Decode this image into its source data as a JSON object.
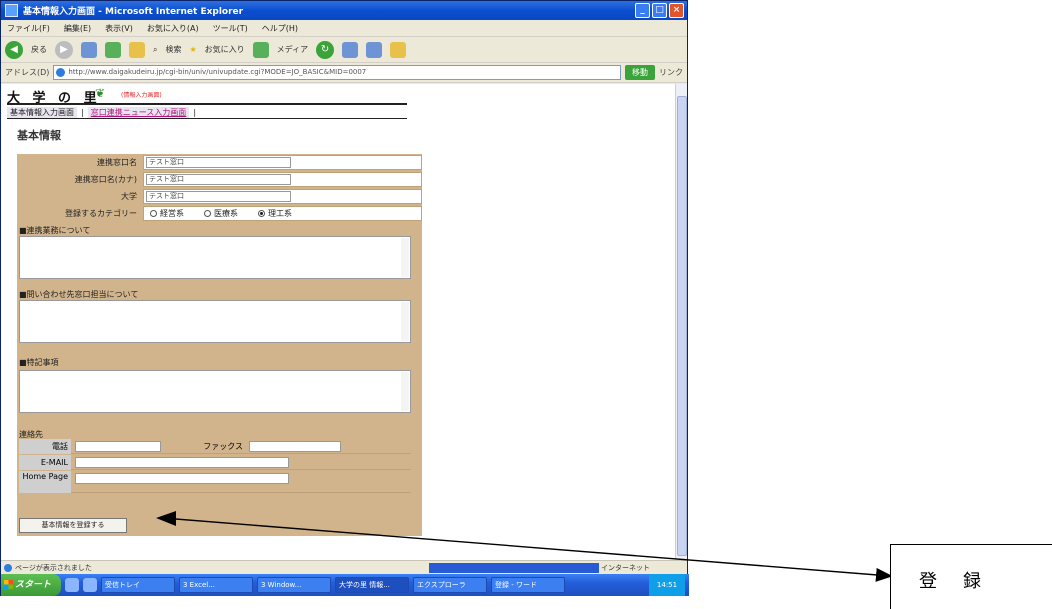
{
  "window": {
    "title": "基本情報入力画面 - Microsoft Internet Explorer"
  },
  "menubar": [
    "ファイル(F)",
    "編集(E)",
    "表示(V)",
    "お気に入り(A)",
    "ツール(T)",
    "ヘルプ(H)"
  ],
  "toolbar": {
    "back_label": "戻る",
    "search_label": "検索",
    "favorites_label": "お気に入り",
    "media_label": "メディア"
  },
  "address": {
    "label": "アドレス(D)",
    "value": "http://www.daigakudeiru.jp/cgi-bin/univ/univupdate.cgi?MODE=JO_BASIC&MID=0007",
    "go_label": "移動",
    "links_label": "リンク"
  },
  "header": {
    "logo": "大 学 の 里",
    "badge": "(情報入力画面)"
  },
  "breadcrumb": {
    "current": "基本情報入力画面",
    "link": "窓口連携ニュース入力画面"
  },
  "page": {
    "title": "基本情報"
  },
  "form": {
    "fields": [
      {
        "label": "連携窓口名",
        "value": "テスト窓口"
      },
      {
        "label": "連携窓口名(カナ)",
        "value": "テスト窓口"
      },
      {
        "label": "大学",
        "value": "テスト窓口"
      }
    ],
    "category": {
      "label": "登録するカテゴリー",
      "options": [
        "経営系",
        "医療系",
        "理工系"
      ],
      "selected": "理工系"
    },
    "sections": [
      "■連携業務について",
      "■問い合わせ先窓口担当について",
      "■特記事項"
    ],
    "contact": {
      "heading": "連絡先",
      "phone_label": "電話",
      "fax_label": "ファックス",
      "email_label": "E-MAIL",
      "homepage_label": "Home Page"
    },
    "submit_label": "基本情報を登録する"
  },
  "status": {
    "text": "ページが表示されました",
    "zone": "インターネット"
  },
  "taskbar": {
    "start_label": "スタート",
    "tasks": [
      "受信トレイ",
      "3 Excel...",
      "3 Window...",
      "大学の里 情報...",
      "エクスプローラ",
      "登録 - ワード"
    ],
    "clock": "14:51"
  },
  "annotation": {
    "label": "登　録"
  }
}
